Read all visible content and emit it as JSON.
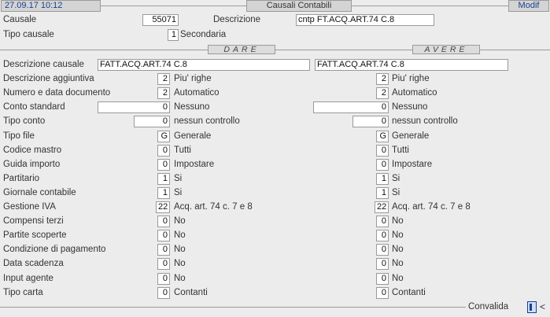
{
  "header": {
    "datetime": "27.09.17 10:12",
    "title": "Causali Contabili",
    "mode": "Modif"
  },
  "causale": {
    "label": "Causale",
    "value": "55071",
    "descrizione_label": "Descrizione",
    "descrizione_value": "cntp FT.ACQ.ART.74 C.8",
    "tipo_label": "Tipo causale",
    "tipo_value": "1",
    "tipo_text": "Secondaria"
  },
  "sections": {
    "dare": "DARE",
    "avere": "AVERE"
  },
  "rows": [
    {
      "label": "Descrizione causale",
      "dare": {
        "value": "FATT.ACQ.ART.74 C.8"
      },
      "avere": {
        "value": "FATT.ACQ.ART.74 C.8"
      }
    },
    {
      "label": "Descrizione aggiuntiva",
      "dare": {
        "value": "2",
        "text": "Piu' righe"
      },
      "avere": {
        "value": "2",
        "text": "Piu' righe"
      }
    },
    {
      "label": "Numero e data documento",
      "dare": {
        "value": "2",
        "text": "Automatico"
      },
      "avere": {
        "value": "2",
        "text": "Automatico"
      }
    },
    {
      "label": "Conto standard",
      "dare": {
        "value": "0",
        "text": "Nessuno"
      },
      "avere": {
        "value": "0",
        "text": "Nessuno"
      }
    },
    {
      "label": "Tipo conto",
      "dare": {
        "value": "0",
        "text": "nessun controllo"
      },
      "avere": {
        "value": "0",
        "text": "nessun controllo"
      }
    },
    {
      "label": "Tipo file",
      "dare": {
        "value": "G",
        "text": "Generale"
      },
      "avere": {
        "value": "G",
        "text": "Generale"
      }
    },
    {
      "label": "Codice mastro",
      "dare": {
        "value": "0",
        "text": "Tutti"
      },
      "avere": {
        "value": "0",
        "text": "Tutti"
      }
    },
    {
      "label": "Guida importo",
      "dare": {
        "value": "0",
        "text": "Impostare"
      },
      "avere": {
        "value": "0",
        "text": "Impostare"
      }
    },
    {
      "label": "Partitario",
      "dare": {
        "value": "1",
        "text": "Si"
      },
      "avere": {
        "value": "1",
        "text": "Si"
      }
    },
    {
      "label": "Giornale contabile",
      "dare": {
        "value": "1",
        "text": "Si"
      },
      "avere": {
        "value": "1",
        "text": "Si"
      }
    },
    {
      "label": "Gestione IVA",
      "dare": {
        "value": "22",
        "text": "Acq. art. 74 c. 7 e 8"
      },
      "avere": {
        "value": "22",
        "text": "Acq. art. 74 c. 7 e 8"
      }
    },
    {
      "label": "Compensi terzi",
      "dare": {
        "value": "0",
        "text": "No"
      },
      "avere": {
        "value": "0",
        "text": "No"
      }
    },
    {
      "label": "Partite scoperte",
      "dare": {
        "value": "0",
        "text": "No"
      },
      "avere": {
        "value": "0",
        "text": "No"
      }
    },
    {
      "label": "Condizione di pagamento",
      "dare": {
        "value": "0",
        "text": "No"
      },
      "avere": {
        "value": "0",
        "text": "No"
      }
    },
    {
      "label": "Data scadenza",
      "dare": {
        "value": "0",
        "text": "No"
      },
      "avere": {
        "value": "0",
        "text": "No"
      }
    },
    {
      "label": "Input agente",
      "dare": {
        "value": "0",
        "text": "No"
      },
      "avere": {
        "value": "0",
        "text": "No"
      }
    },
    {
      "label": "Tipo carta",
      "dare": {
        "value": "0",
        "text": "Contanti"
      },
      "avere": {
        "value": "0",
        "text": "Contanti"
      }
    }
  ],
  "footer": {
    "convalida": "Convalida",
    "arrow": "<"
  }
}
